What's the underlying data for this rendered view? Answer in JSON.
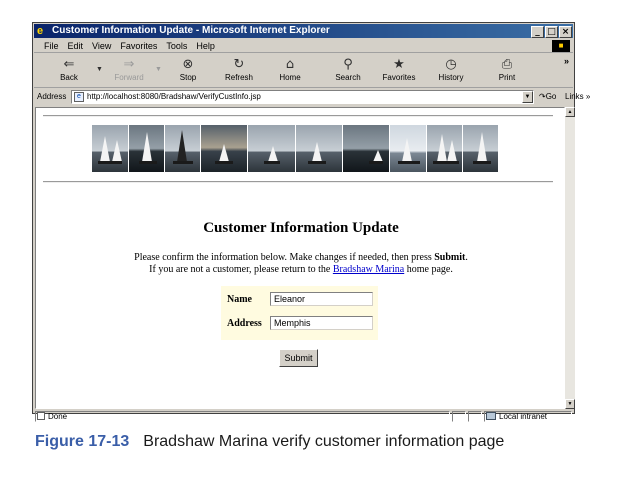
{
  "window": {
    "title": "Customer Information Update - Microsoft Internet Explorer",
    "controls": [
      "_",
      "□",
      "×"
    ]
  },
  "menu": [
    "File",
    "Edit",
    "View",
    "Favorites",
    "Tools",
    "Help"
  ],
  "toolbar": {
    "back": "Back",
    "forward": "Forward",
    "stop": "Stop",
    "refresh": "Refresh",
    "home": "Home",
    "search": "Search",
    "favorites": "Favorites",
    "history": "History",
    "print": "Print",
    "more": "»"
  },
  "address": {
    "label": "Address",
    "url": "http://localhost:8080/Bradshaw/VerifyCustInfo.jsp",
    "go": "Go",
    "links": "Links »"
  },
  "page": {
    "heading": "Customer Information Update",
    "line1_prefix": "Please confirm the information below. Make changes if needed, then press ",
    "line1_bold": "Submit",
    "line1_suffix": ".",
    "line2_prefix": "If you are not a customer, please return to the ",
    "line2_link": "Bradshaw Marina",
    "line2_suffix": " home page.",
    "form": {
      "name_label": "Name",
      "name_value": "Eleanor",
      "address_label": "Address",
      "address_value": "Memphis",
      "submit": "Submit"
    }
  },
  "status": {
    "text": "Done",
    "zone": "Local intranet"
  },
  "caption": {
    "number": "Figure 17-13",
    "text": "Bradshaw Marina verify customer information page"
  }
}
